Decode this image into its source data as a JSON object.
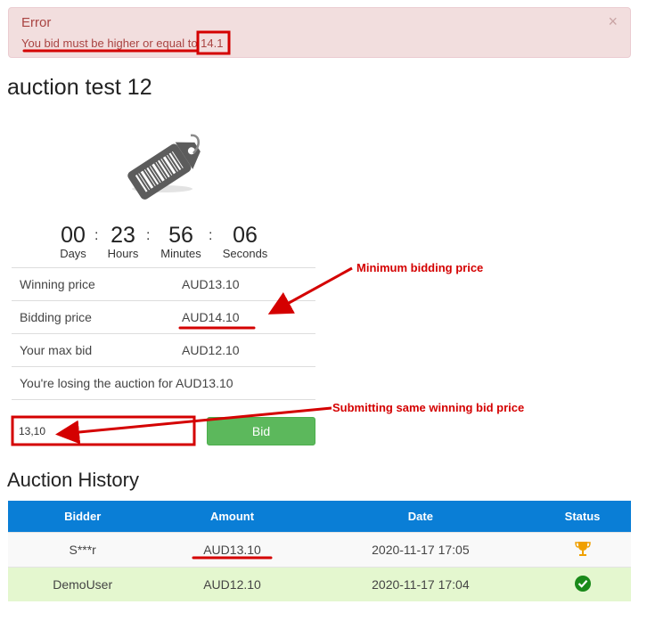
{
  "alert": {
    "title": "Error",
    "message": "You bid must be higher or equal to 14.1",
    "close": "×"
  },
  "page": {
    "title": "auction test 12"
  },
  "icons": {
    "product": "price-tag-icon",
    "close": "close-icon",
    "trophy": "trophy-icon",
    "check": "check-circle-icon"
  },
  "countdown": [
    {
      "value": "00",
      "label": "Days"
    },
    {
      "value": "23",
      "label": "Hours"
    },
    {
      "value": "56",
      "label": "Minutes"
    },
    {
      "value": "06",
      "label": "Seconds"
    }
  ],
  "countdown_sep": ":",
  "info": {
    "winning_label": "Winning price",
    "winning_value": "AUD13.10",
    "bidding_label": "Bidding price",
    "bidding_value": "AUD14.10",
    "maxbid_label": "Your max bid",
    "maxbid_value": "AUD12.10",
    "status_text": "You're losing the auction for AUD13.10"
  },
  "bid_form": {
    "input_value": "13,10",
    "button_label": "Bid"
  },
  "history": {
    "title": "Auction History",
    "columns": [
      "Bidder",
      "Amount",
      "Date",
      "Status"
    ],
    "rows": [
      {
        "bidder": "S***r",
        "amount": "AUD13.10",
        "date": "2020-11-17 17:05",
        "status_icon": "trophy-icon"
      },
      {
        "bidder": "DemoUser",
        "amount": "AUD12.10",
        "date": "2020-11-17 17:04",
        "status_icon": "check-circle-icon"
      }
    ]
  },
  "annotations": {
    "min_price": "Minimum bidding price",
    "same_price": "Submitting same winning bid price"
  },
  "colors": {
    "alert_bg": "#f2dede",
    "alert_text": "#a94442",
    "bid_button": "#5cb85c",
    "table_header": "#0a7ed6",
    "highlight_row": "#e4f7cf",
    "annotation": "#d40000"
  }
}
